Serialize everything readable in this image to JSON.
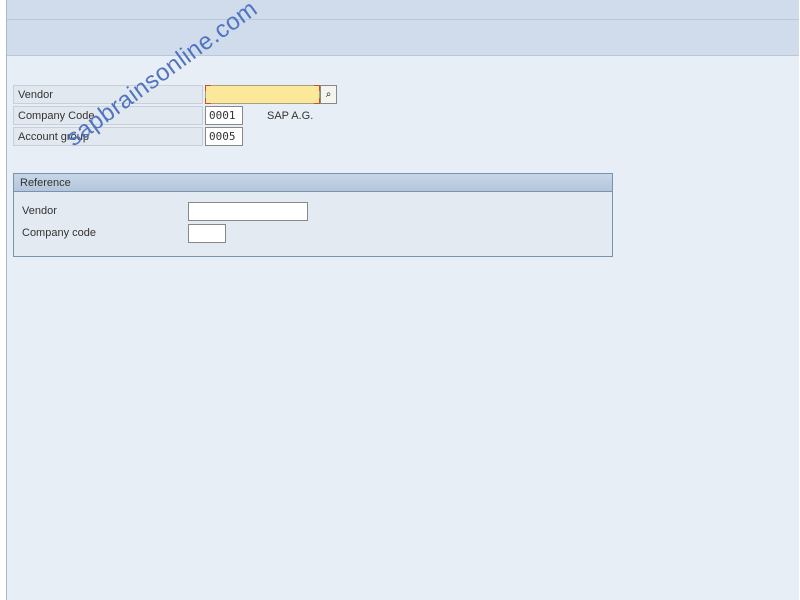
{
  "main": {
    "vendor_label": "Vendor",
    "vendor_value": "",
    "company_code_label": "Company Code",
    "company_code_value": "0001",
    "company_code_desc": "SAP A.G.",
    "account_group_label": "Account group",
    "account_group_value": "0005"
  },
  "reference": {
    "title": "Reference",
    "vendor_label": "Vendor",
    "vendor_value": "",
    "company_code_label": "Company code",
    "company_code_value": ""
  },
  "watermark": "sapbrainsonline.com",
  "icons": {
    "search_help": "⌕"
  }
}
